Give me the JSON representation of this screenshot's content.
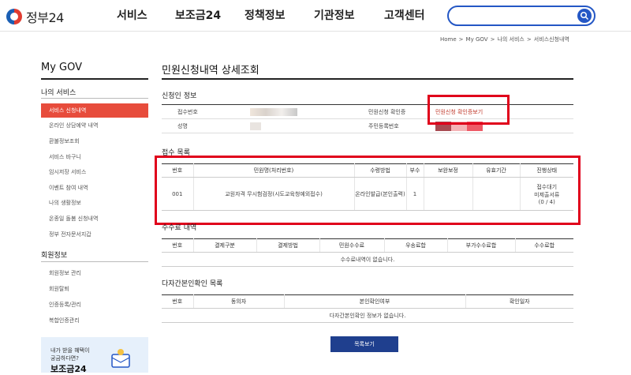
{
  "header": {
    "logo_text": "정부24",
    "nav": [
      "서비스",
      "보조금24",
      "정책정보",
      "기관정보",
      "고객센터"
    ],
    "search_placeholder": ""
  },
  "breadcrumb": [
    "Home",
    ">",
    "My GOV",
    ">",
    "나의 서비스",
    ">",
    "서비스신청내역"
  ],
  "sidebar": {
    "title": "My GOV",
    "section1": "나의 서비스",
    "items1": [
      "서비스 신청내역",
      "온라인 상담예약 내역",
      "환불정보조회",
      "서비스 바구니",
      "임시저장 서비스",
      "이벤트 참여 내역",
      "나의 생활정보",
      "온종일 돌봄 신청내역",
      "정부 전자문서지갑"
    ],
    "section2": "회원정보",
    "items2": [
      "회원정보 관리",
      "회원탈퇴",
      "인증등록/관리",
      "복합인증관리"
    ],
    "banner_line1": "내가 받을 혜택이",
    "banner_line2": "궁금하다면?",
    "banner_big": "보조금24"
  },
  "main": {
    "title": "민원신청내역 상세조회",
    "applicant_heading": "신청인 정보",
    "info": {
      "receipt_label": "접수번호",
      "confirm_label": "민원신청 확인증",
      "confirm_link": "민원신청 확인증보기",
      "name_label": "성명",
      "id_label": "주민등록번호"
    },
    "receipt_heading": "접수 목록",
    "receipt_cols": [
      "번호",
      "민원명(처리번호)",
      "수령방법",
      "부수",
      "보완보정",
      "유효기간",
      "진행상태"
    ],
    "receipt_row": {
      "no": "001",
      "name": "교원자격 무시험검정(시도교육청예외접수)",
      "method": "온라인발급(본인출력)",
      "copies": "1",
      "supplement": "",
      "validity": "",
      "status1": "접수대기",
      "status2": "미제출서류",
      "status3": "(0 / 4)"
    },
    "fee_heading": "수수료 내역",
    "fee_cols": [
      "번호",
      "결제구분",
      "결제방법",
      "민원수수료",
      "우송료합",
      "부가수수료합",
      "수수료합"
    ],
    "fee_empty": "수수료내역이 없습니다.",
    "multi_heading": "다자간본인확인 목록",
    "multi_cols": [
      "번호",
      "동의자",
      "본인확인여부",
      "확인일자"
    ],
    "multi_empty": "다자간본인확인 정보가 없습니다.",
    "list_button": "목록보기"
  },
  "colors": {
    "brand_blue": "#2457c5",
    "active_red": "#e74c3c",
    "button_navy": "#1f3f8e",
    "highlight_red": "#e0001b"
  }
}
